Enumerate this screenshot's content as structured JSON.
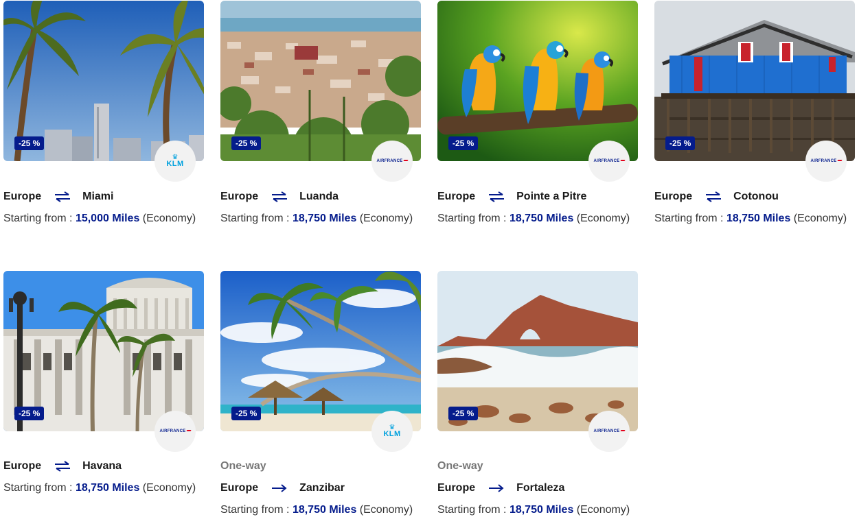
{
  "cards": [
    {
      "origin": "Europe",
      "destination": "Miami",
      "trip_type": "",
      "arrow": "round-trip-icon",
      "discount": "-25 %",
      "airline": "KLM",
      "price_prefix": "Starting from :",
      "miles": "15,000 Miles",
      "cabin": "(Economy)"
    },
    {
      "origin": "Europe",
      "destination": "Luanda",
      "trip_type": "",
      "arrow": "round-trip-icon",
      "discount": "-25 %",
      "airline": "AIRFRANCE",
      "price_prefix": "Starting from :",
      "miles": "18,750 Miles",
      "cabin": "(Economy)"
    },
    {
      "origin": "Europe",
      "destination": "Pointe a Pitre",
      "trip_type": "",
      "arrow": "round-trip-icon",
      "discount": "-25 %",
      "airline": "AIRFRANCE",
      "price_prefix": "Starting from :",
      "miles": "18,750 Miles",
      "cabin": "(Economy)"
    },
    {
      "origin": "Europe",
      "destination": "Cotonou",
      "trip_type": "",
      "arrow": "round-trip-icon",
      "discount": "-25 %",
      "airline": "AIRFRANCE",
      "price_prefix": "Starting from :",
      "miles": "18,750 Miles",
      "cabin": "(Economy)"
    },
    {
      "origin": "Europe",
      "destination": "Havana",
      "trip_type": "",
      "arrow": "round-trip-icon",
      "discount": "-25 %",
      "airline": "AIRFRANCE",
      "price_prefix": "Starting from :",
      "miles": "18,750 Miles",
      "cabin": "(Economy)"
    },
    {
      "origin": "Europe",
      "destination": "Zanzibar",
      "trip_type": "One-way",
      "arrow": "one-way-arrow-icon",
      "discount": "-25 %",
      "airline": "KLM",
      "price_prefix": "Starting from :",
      "miles": "18,750 Miles",
      "cabin": "(Economy)"
    },
    {
      "origin": "Europe",
      "destination": "Fortaleza",
      "trip_type": "One-way",
      "arrow": "one-way-arrow-icon",
      "discount": "-25 %",
      "airline": "AIRFRANCE",
      "price_prefix": "Starting from :",
      "miles": "18,750 Miles",
      "cabin": "(Economy)"
    }
  ],
  "colors": {
    "brand": "#051c8c",
    "klm": "#00a1de",
    "af_red": "#e2001a",
    "logo_bg": "#f2f2f2"
  }
}
